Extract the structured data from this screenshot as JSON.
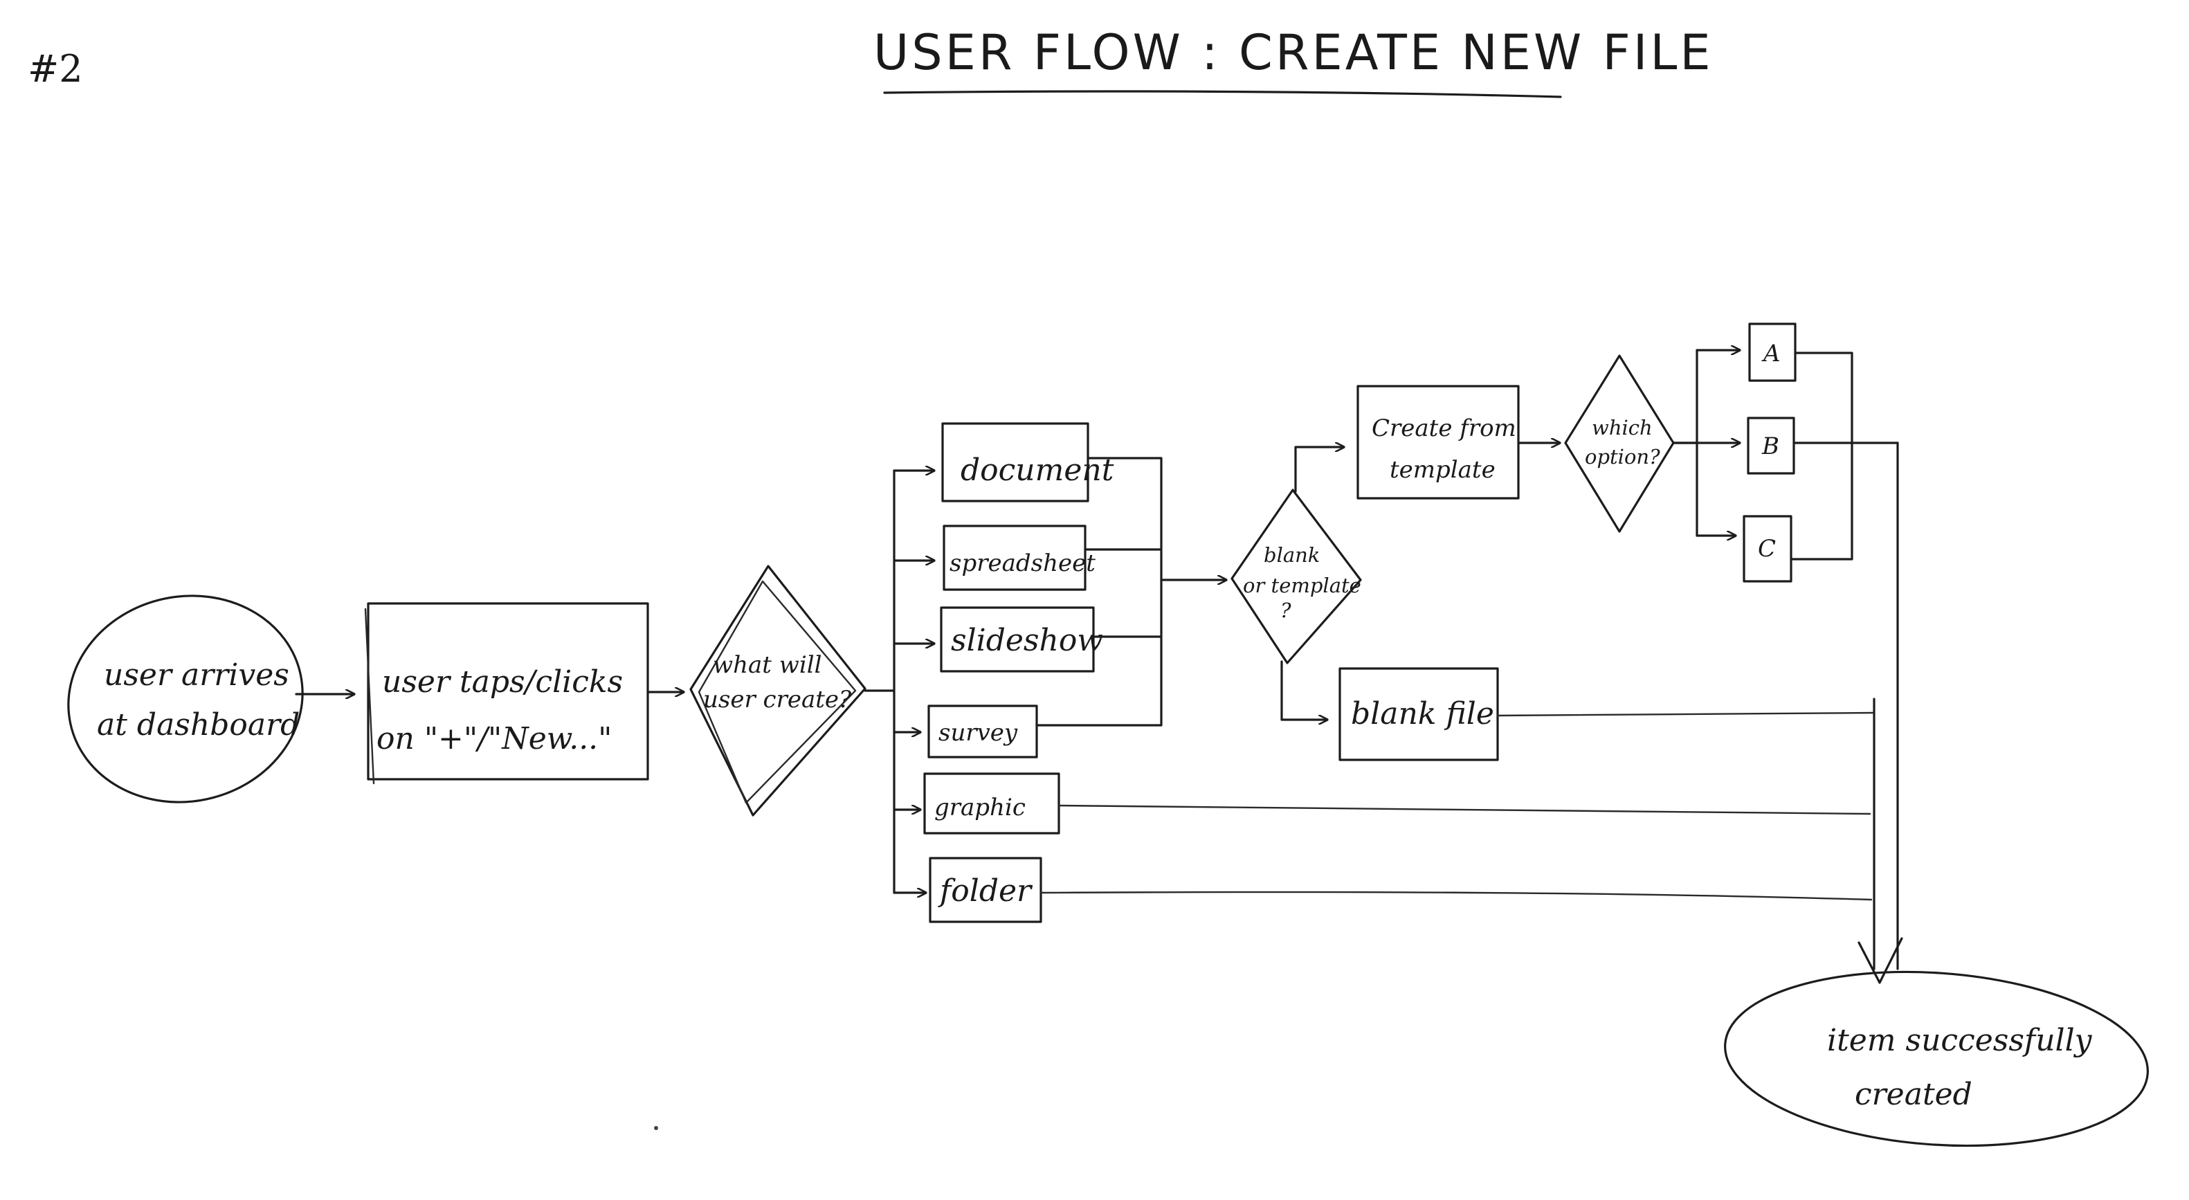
{
  "page_number": "#2",
  "title": "USER FLOW : CREATE NEW FILE",
  "nodes": {
    "start": {
      "line1": "user arrives",
      "line2": "at dashboard"
    },
    "taps": {
      "line1": "user taps/clicks",
      "line2": "on \"+\"/\"New...\""
    },
    "what": {
      "line1": "what will",
      "line2": "user create?"
    },
    "document": "document",
    "spreadsheet": "spreadsheet",
    "slideshow": "slideshow",
    "survey": "survey",
    "graphic": "graphic",
    "folder": "folder",
    "blank_or_template": {
      "line1": "blank",
      "line2": "or template",
      "line3": "?"
    },
    "create_from_template": {
      "line1": "Create from",
      "line2": "template"
    },
    "which_option": {
      "line1": "which",
      "line2": "option?"
    },
    "option_a": "A",
    "option_b": "B",
    "option_c": "C",
    "blank_file": "blank file",
    "end": {
      "line1": "item successfully",
      "line2": "created"
    }
  }
}
